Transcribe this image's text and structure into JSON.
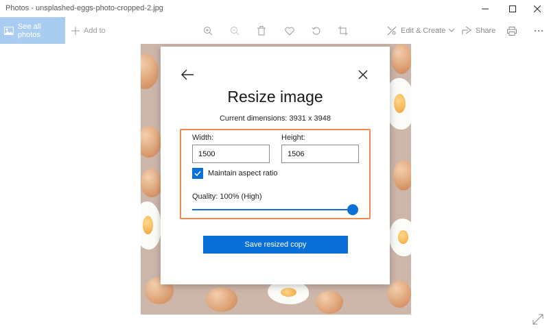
{
  "window": {
    "title": "Photos - unsplashed-eggs-photo-cropped-2.jpg"
  },
  "toolbar": {
    "see_all_label": "See all photos",
    "add_to_label": "Add to",
    "edit_create_label": "Edit & Create",
    "share_label": "Share",
    "accent": "#a9cdf0"
  },
  "dialog": {
    "title": "Resize image",
    "current_dimensions": "Current dimensions: 3931 x 3948",
    "width_label": "Width:",
    "width_value": "1500",
    "height_label": "Height:",
    "height_value": "1506",
    "maintain_aspect_label": "Maintain aspect ratio",
    "maintain_aspect_checked": true,
    "quality_label": "Quality: 100% (High)",
    "quality_value": 1.0,
    "save_label": "Save resized copy",
    "accent": "#0b6fd8",
    "highlight_color": "#ef8a4f"
  },
  "icons": [
    "image-icon",
    "plus-icon",
    "zoom-in-icon",
    "zoom-out-icon",
    "trash-icon",
    "heart-icon",
    "rotate-icon",
    "crop-icon",
    "edit-create-icon",
    "chevron-down-icon",
    "share-icon",
    "print-icon",
    "more-icon",
    "back-arrow-icon",
    "close-icon",
    "checkmark-icon",
    "expand-icon"
  ]
}
